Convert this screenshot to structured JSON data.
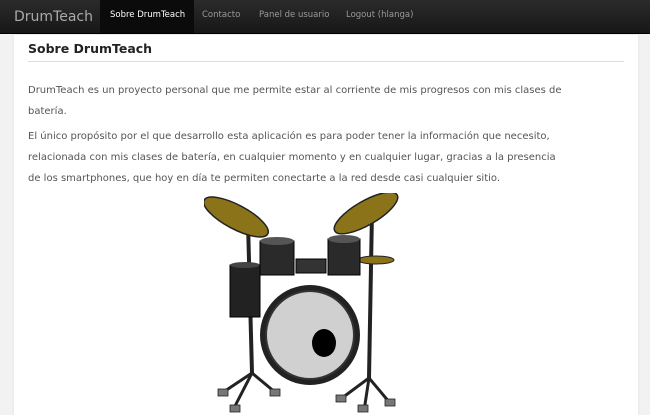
{
  "navbar": {
    "brand": "DrumTeach",
    "items": [
      {
        "label": "Sobre DrumTeach",
        "active": true
      },
      {
        "label": "Contacto",
        "active": false
      },
      {
        "label": "Panel de usuario",
        "active": false
      },
      {
        "label": "Logout (hlanga)",
        "active": false
      }
    ]
  },
  "main": {
    "title": "Sobre DrumTeach",
    "paragraphs": [
      "DrumTeach es un proyecto personal que me permite estar al corriente de mis progresos con mis clases de batería.",
      "El único propósito por el que desarrollo esta aplicación es para poder tener la información que necesito, relacionada con mis clases de batería, en cualquier momento y en cualquier lugar, gracias a la presencia de los smartphones, que hoy en día te permiten conectarte a la red desde casi cualquier sitio."
    ]
  },
  "colors": {
    "cymbal": "#8a7318",
    "drum_shell": "#222222",
    "drum_head": "#d0d0d0"
  },
  "image": {
    "icon": "drum-kit-illustration"
  }
}
